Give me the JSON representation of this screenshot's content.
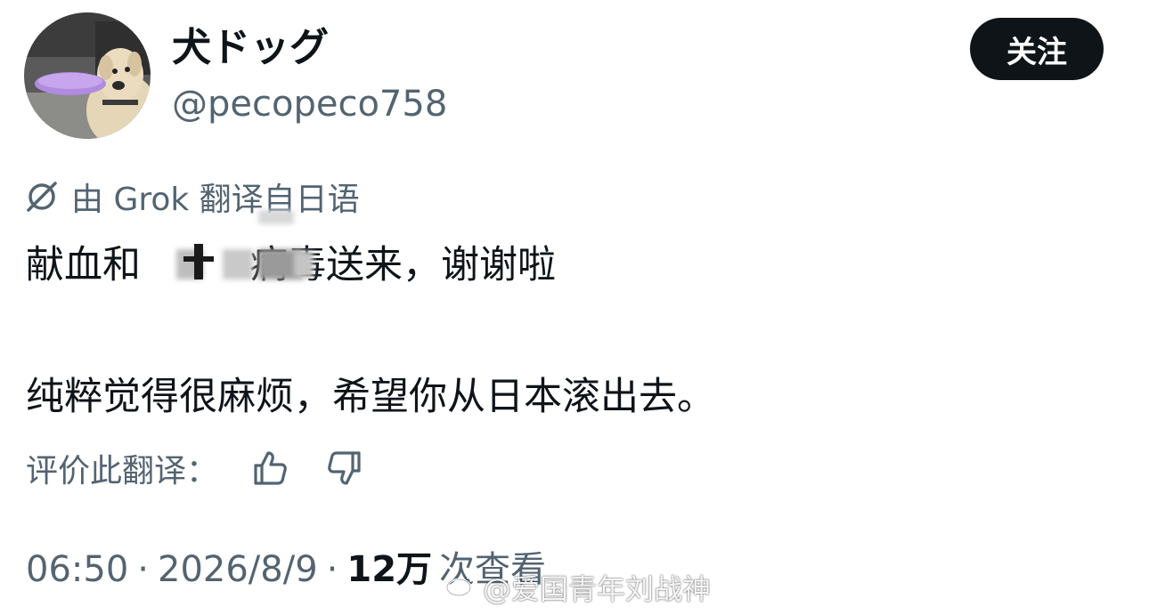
{
  "user": {
    "display_name": "犬ドッグ",
    "handle": "@pecopeco758",
    "avatar_icon": "dog-with-frisbee-avatar"
  },
  "follow_button": {
    "label": "关注"
  },
  "translation": {
    "icon": "grok-icon",
    "label": "由 Grok 翻译自日语"
  },
  "tweet": {
    "line1": "献血和",
    "line1_rest": "病毒送来，谢谢啦",
    "line2": "纯粹觉得很麻烦，希望你从日本滚出去。"
  },
  "rate_translation": {
    "label": "评价此翻译：",
    "thumbs_up_icon": "thumbs-up-icon",
    "thumbs_down_icon": "thumbs-down-icon"
  },
  "meta": {
    "time": "06:50",
    "separator": "·",
    "date": "2026/8/9",
    "views_count": "12万",
    "views_label": "次查看"
  },
  "watermark": {
    "icon": "weibo-icon",
    "text": "@爱国青年刘战神"
  },
  "colors": {
    "text_primary": "#0f1419",
    "text_secondary": "#536471",
    "button_bg": "#0f1419",
    "button_text": "#ffffff",
    "background": "#ffffff"
  }
}
